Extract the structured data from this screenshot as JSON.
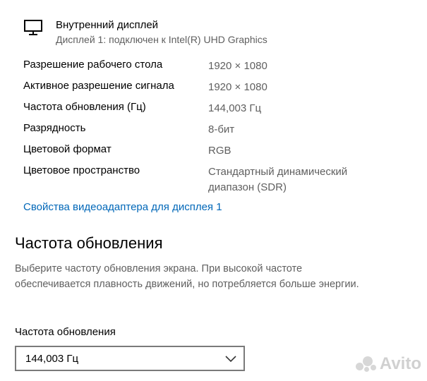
{
  "display": {
    "name": "Внутренний дисплей",
    "subtitle": "Дисплей 1: подключен к Intel(R) UHD Graphics",
    "icon": "monitor-icon"
  },
  "properties": [
    {
      "label": "Разрешение рабочего стола",
      "value": "1920 × 1080"
    },
    {
      "label": "Активное разрешение сигнала",
      "value": "1920 × 1080"
    },
    {
      "label": "Частота обновления (Гц)",
      "value": "144,003 Гц"
    },
    {
      "label": "Разрядность",
      "value": "8-бит"
    },
    {
      "label": "Цветовой формат",
      "value": "RGB"
    },
    {
      "label": "Цветовое пространство",
      "value": "Стандартный динамический диапазон (SDR)"
    }
  ],
  "adapter_link": "Свойства видеоадаптера для дисплея 1",
  "refresh_section": {
    "title": "Частота обновления",
    "description": "Выберите частоту обновления экрана. При высокой частоте обеспечивается плавность движений, но потребляется больше энергии.",
    "dropdown_label": "Частота обновления",
    "dropdown_value": "144,003 Гц"
  },
  "watermark": "Avito",
  "colors": {
    "link": "#0067b8",
    "secondary_text": "#5f5f5f",
    "dropdown_border": "#7a7a7a"
  }
}
